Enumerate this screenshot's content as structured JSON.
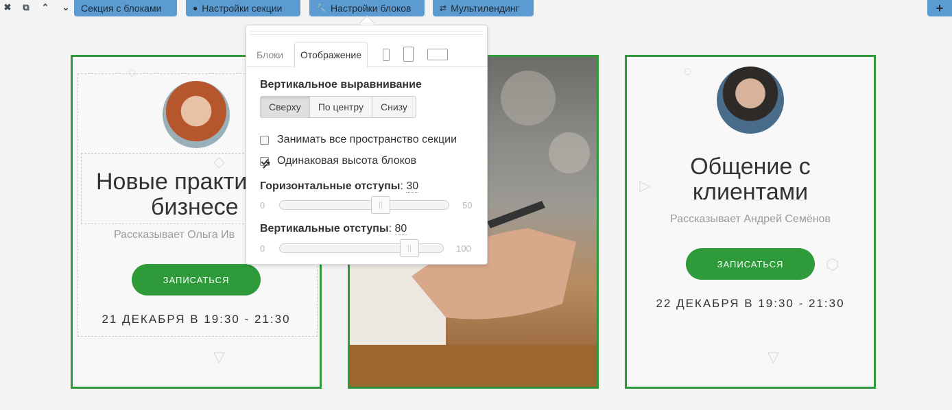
{
  "toolbar": {
    "icons": [
      "close-icon",
      "copy-icon",
      "move-up-icon",
      "move-down-icon"
    ],
    "section_blocks": "Секция с блоками",
    "section_settings": "Настройки секции",
    "block_settings": "Настройки блоков",
    "multilanding": "Мультилендинг"
  },
  "popup": {
    "tabs": [
      "Блоки",
      "Отображение"
    ],
    "active_tab": "Отображение",
    "vertical_align_heading": "Вертикальное выравнивание",
    "align_options": [
      "Сверху",
      "По центру",
      "Снизу"
    ],
    "selected_align": "Сверху",
    "fill_section_label": "Занимать все пространство секции",
    "fill_section_checked": false,
    "equal_height_label": "Одинаковая высота блоков",
    "equal_height_checked": true,
    "h_spacing_label": "Горизонтальные отступы",
    "h_spacing_value": "30",
    "h_min": "0",
    "h_max": "50",
    "v_spacing_label": "Вертикальные отступы",
    "v_spacing_value": "80",
    "v_min": "0",
    "v_max": "100"
  },
  "cards": [
    {
      "title_line1": "Новые практи",
      "title_line2": "бизнесе",
      "subtitle": "Рассказывает Ольга Ив",
      "button": "ЗАПИСАТЬСЯ",
      "date": "21 ДЕКАБРЯ В 19:30 - 21:30"
    },
    {
      "title_line1": "Общение с",
      "title_line2": "клиентами",
      "subtitle": "Рассказывает Андрей Семёнов",
      "button": "ЗАПИСАТЬСЯ",
      "date": "22 ДЕКАБРЯ В 19:30 - 21:30"
    }
  ],
  "colors": {
    "accent_green": "#2e9a3a",
    "toolbar_blue": "#5b9bd1"
  }
}
